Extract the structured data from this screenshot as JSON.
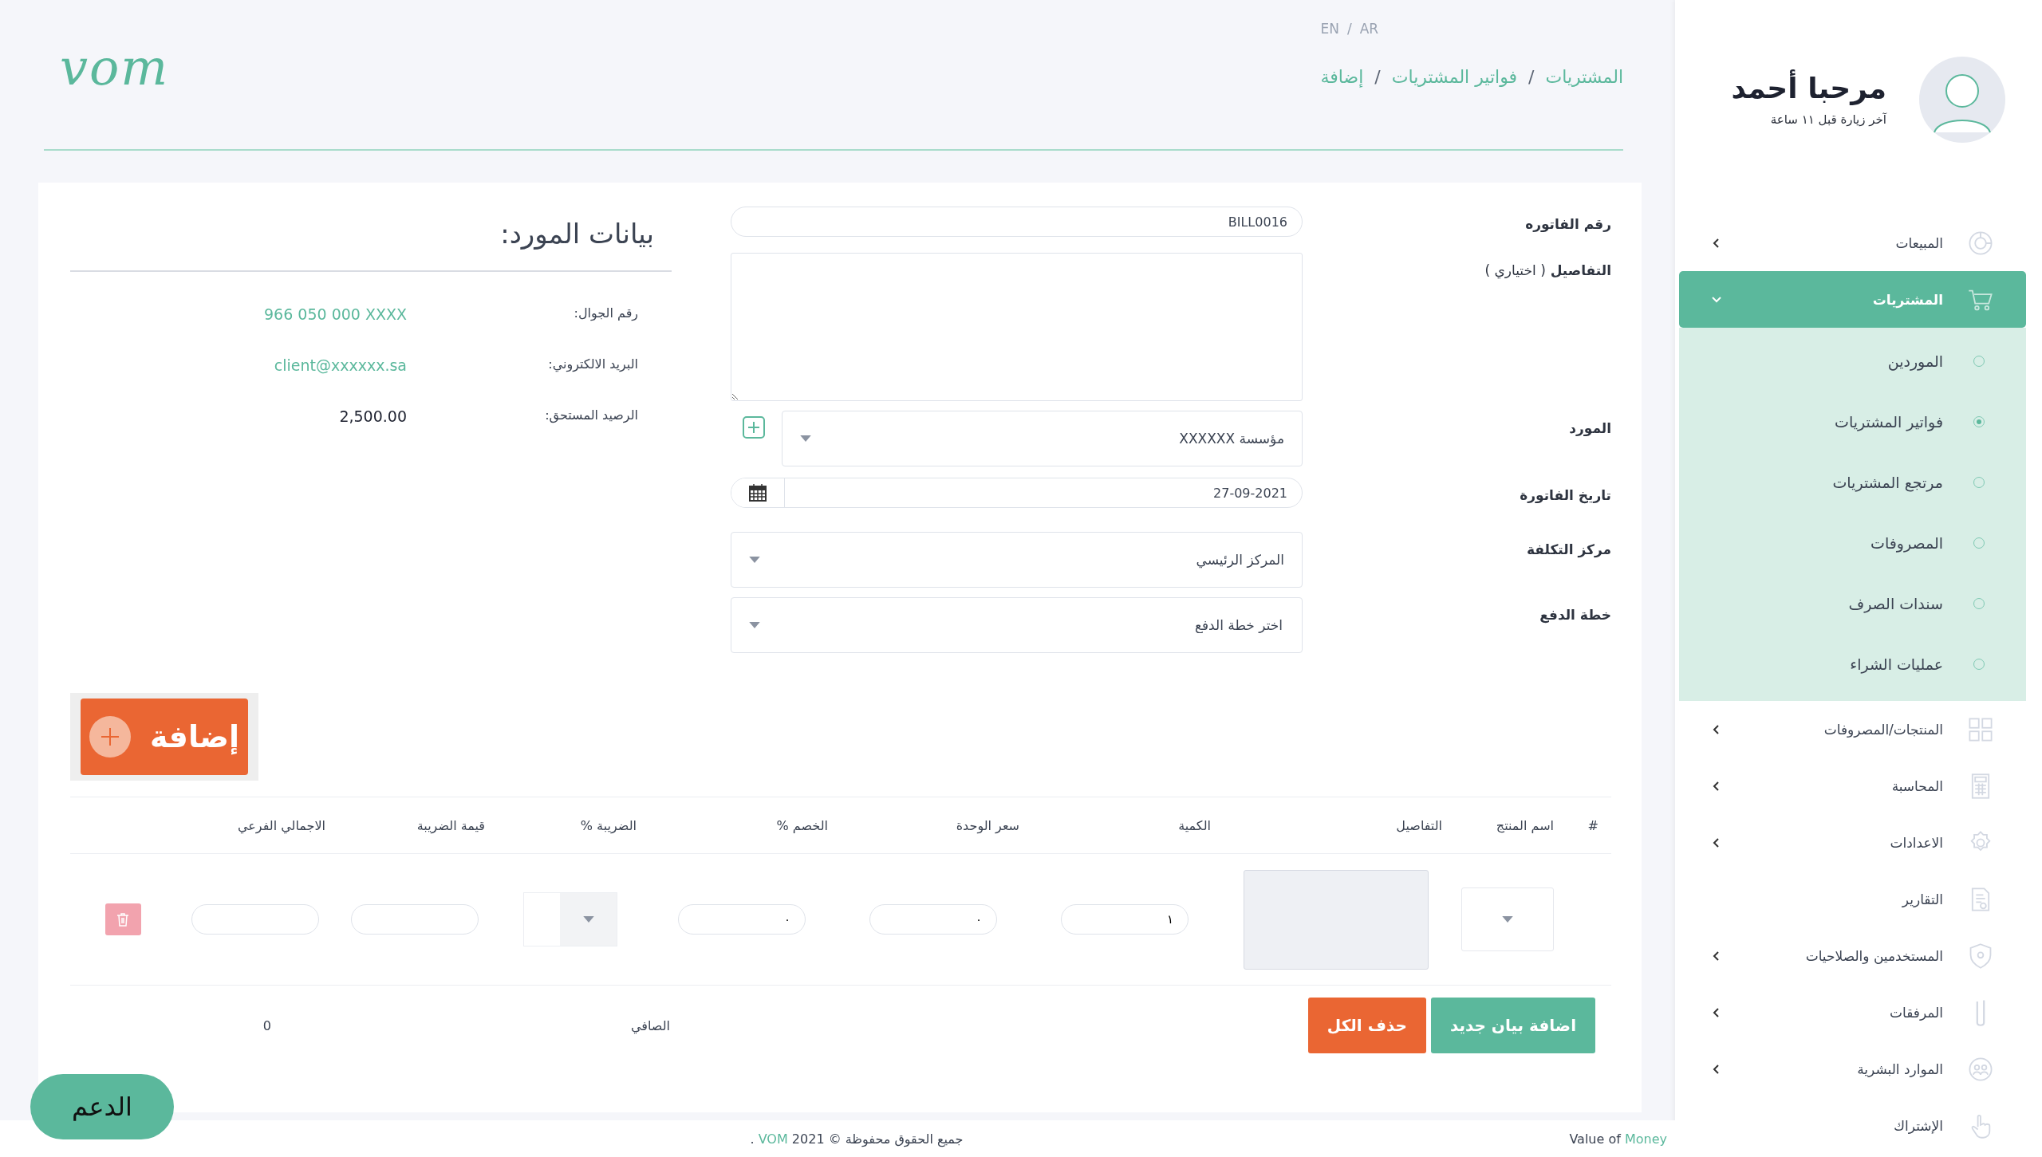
{
  "header": {
    "logo": "vom",
    "languages": [
      "AR",
      "EN"
    ],
    "separator": "/",
    "breadcrumb": [
      "المشتريات",
      "فواتير المشتريات",
      "إضافة"
    ]
  },
  "form": {
    "fields": [
      {
        "kind": "text",
        "label": "رقم الفاتوره",
        "value": "BILL0016"
      },
      {
        "kind": "textarea",
        "label": "التفاصيل",
        "note": "( اختياري )"
      },
      {
        "kind": "select-add",
        "label": "المورد",
        "value": "مؤسسة XXXXXX"
      },
      {
        "kind": "date",
        "label": "تاريخ الفاتورة",
        "value": "27-09-2021"
      },
      {
        "kind": "select",
        "label": "مركز التكلفة",
        "value": "المركز الرئيسي"
      },
      {
        "kind": "select",
        "label": "خطة الدفع",
        "placeholder": "اختر خطة الدفع"
      }
    ]
  },
  "supplier": {
    "title": "بيانات المورد:",
    "rows": [
      {
        "kind": "link",
        "label": "رقم الجوال:",
        "value": "966 050 000 XXXX"
      },
      {
        "kind": "link",
        "label": "البريد الالكتروني:",
        "value": "client@xxxxxx.sa"
      },
      {
        "kind": "plain",
        "label": "الرصيد المستحق:",
        "value": "2,500.00"
      }
    ]
  },
  "add_button": "إضافة",
  "table": {
    "columns": [
      "#",
      "اسم المنتج",
      "التفاصيل",
      "الكمية",
      "سعر الوحدة",
      "الخصم %",
      "الضريبة %",
      "قيمة الضريبة",
      "الاجمالي الفرعي"
    ],
    "rows": [
      {
        "quantity": "١",
        "unit_price": "٠",
        "discount": "٠"
      }
    ]
  },
  "actions": [
    {
      "kind": "primary",
      "label": "اضافة بيان جديد"
    },
    {
      "kind": "danger",
      "label": "حذف الكل"
    }
  ],
  "totals": {
    "label": "الصافي",
    "value": "0"
  },
  "support_button": "الدعم",
  "footer": {
    "copyright": "جميع الحقوق محفوظة © 2021",
    "brand": "VOM",
    "tail": ".",
    "tagline": "Value of",
    "tagline_brand": "Money"
  },
  "sidebar": {
    "user": {
      "greeting": "مرحبا أحمد",
      "last_visit": "آخر زيارة قبل ١١ ساعة"
    },
    "items": [
      {
        "label": "المبيعات",
        "kind": "chart",
        "expandable": true,
        "expanded": false,
        "selected": false
      },
      {
        "label": "المشتريات",
        "kind": "cart",
        "expandable": true,
        "expanded": true,
        "selected": true,
        "children": [
          {
            "label": "الموردين",
            "selected": false
          },
          {
            "label": "فواتير المشتريات",
            "selected": true
          },
          {
            "label": "مرتجع المشتريات",
            "selected": false
          },
          {
            "label": "المصروفات",
            "selected": false
          },
          {
            "label": "سندات الصرف",
            "selected": false
          },
          {
            "label": "عمليات الشراء",
            "selected": false
          }
        ]
      },
      {
        "label": "المنتجات/المصروفات",
        "kind": "grid",
        "expandable": true,
        "expanded": false,
        "selected": false
      },
      {
        "label": "المحاسبة",
        "kind": "calculator",
        "expandable": true,
        "expanded": false,
        "selected": false
      },
      {
        "label": "الاعدادات",
        "kind": "gear",
        "expandable": true,
        "expanded": false,
        "selected": false
      },
      {
        "label": "التقارير",
        "kind": "report",
        "expandable": false,
        "selected": false
      },
      {
        "label": "المستخدمين والصلاحيات",
        "kind": "shield",
        "expandable": true,
        "expanded": false,
        "selected": false
      },
      {
        "label": "المرفقات",
        "kind": "clip",
        "expandable": true,
        "expanded": false,
        "selected": false
      },
      {
        "label": "الموارد البشرية",
        "kind": "people",
        "expandable": true,
        "expanded": false,
        "selected": false
      },
      {
        "label": "الإشتراك",
        "kind": "hand",
        "expandable": false,
        "selected": false
      }
    ]
  }
}
